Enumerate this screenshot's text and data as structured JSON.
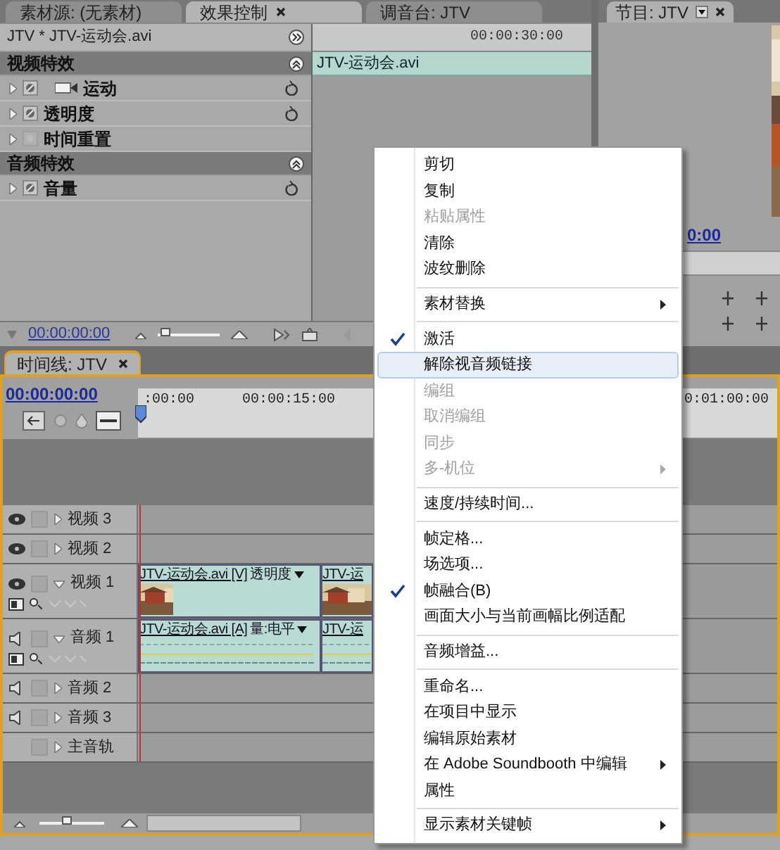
{
  "effect_panel": {
    "tabs": [
      {
        "label": "素材源: (无素材)",
        "selected": false
      },
      {
        "label": "效果控制",
        "selected": true
      },
      {
        "label": "调音台: JTV",
        "selected": false
      }
    ],
    "clip_title": "JTV * JTV-运动会.avi",
    "ruler_time": "00:00:30:00",
    "clip_bar": "JTV-运动会.avi",
    "sections": [
      {
        "title": "视频特效",
        "effects": [
          {
            "name": "运动",
            "kind": "motion",
            "enabled": true,
            "reset_button": true
          },
          {
            "name": "透明度",
            "kind": "plain",
            "enabled": true,
            "reset_button": true
          },
          {
            "name": "时间重置",
            "kind": "plain",
            "enabled": false,
            "reset_button": false
          }
        ]
      },
      {
        "title": "音频特效",
        "effects": [
          {
            "name": "音量",
            "kind": "plain",
            "enabled": true,
            "reset_button": true
          }
        ]
      }
    ],
    "timecode": "00:00:00:00",
    "zoom": {
      "level": 0.05
    }
  },
  "program_panel": {
    "tab": "节目: JTV",
    "timecode": "0:00"
  },
  "timeline": {
    "tab": "时间线: JTV",
    "timecode": "00:00:00:00",
    "ruler": [
      ":00:00",
      "00:00:15:00",
      "0:01:00:00"
    ],
    "tracks": [
      {
        "name": "视频 3",
        "kind": "video",
        "expanded": false
      },
      {
        "name": "视频 2",
        "kind": "video",
        "expanded": false
      },
      {
        "name": "视频 1",
        "kind": "video",
        "expanded": true,
        "clips": [
          {
            "label": "JTV-运动会.avi [V]",
            "effect": "透明度"
          },
          {
            "label": "JTV-运"
          }
        ]
      },
      {
        "name": "音频 1",
        "kind": "audio",
        "expanded": true,
        "clips": [
          {
            "label": "JTV-运动会.avi [A]",
            "effect": "量:电平"
          },
          {
            "label": "JTV-运"
          }
        ]
      },
      {
        "name": "音频 2",
        "kind": "audio",
        "expanded": false
      },
      {
        "name": "音频 3",
        "kind": "audio",
        "expanded": false
      },
      {
        "name": "主音轨",
        "kind": "master",
        "expanded": false
      }
    ],
    "zoom": {
      "level": 0.4
    }
  },
  "context_menu": {
    "items": [
      {
        "kind": "item",
        "label": "剪切",
        "disabled": false,
        "checked": false,
        "selected": false,
        "submenu": false
      },
      {
        "kind": "item",
        "label": "复制",
        "disabled": false,
        "checked": false,
        "selected": false,
        "submenu": false
      },
      {
        "kind": "item",
        "label": "粘贴属性",
        "disabled": true,
        "checked": false,
        "selected": false,
        "submenu": false
      },
      {
        "kind": "item",
        "label": "清除",
        "disabled": false,
        "checked": false,
        "selected": false,
        "submenu": false
      },
      {
        "kind": "item",
        "label": "波纹删除",
        "disabled": false,
        "checked": false,
        "selected": false,
        "submenu": false
      },
      {
        "kind": "separator"
      },
      {
        "kind": "item",
        "label": "素材替换",
        "disabled": false,
        "checked": false,
        "selected": false,
        "submenu": true
      },
      {
        "kind": "separator"
      },
      {
        "kind": "item",
        "label": "激活",
        "disabled": false,
        "checked": true,
        "selected": false,
        "submenu": false
      },
      {
        "kind": "item",
        "label": "解除视音频链接",
        "disabled": false,
        "checked": false,
        "selected": true,
        "submenu": false
      },
      {
        "kind": "item",
        "label": "编组",
        "disabled": true,
        "checked": false,
        "selected": false,
        "submenu": false
      },
      {
        "kind": "item",
        "label": "取消编组",
        "disabled": true,
        "checked": false,
        "selected": false,
        "submenu": false
      },
      {
        "kind": "item",
        "label": "同步",
        "disabled": true,
        "checked": false,
        "selected": false,
        "submenu": false
      },
      {
        "kind": "item",
        "label": "多-机位",
        "disabled": true,
        "checked": false,
        "selected": false,
        "submenu": true
      },
      {
        "kind": "separator"
      },
      {
        "kind": "item",
        "label": "速度/持续时间...",
        "disabled": false,
        "checked": false,
        "selected": false,
        "submenu": false
      },
      {
        "kind": "separator"
      },
      {
        "kind": "item",
        "label": "帧定格...",
        "disabled": false,
        "checked": false,
        "selected": false,
        "submenu": false
      },
      {
        "kind": "item",
        "label": "场选项...",
        "disabled": false,
        "checked": false,
        "selected": false,
        "submenu": false
      },
      {
        "kind": "item",
        "label": "帧融合(B)",
        "disabled": false,
        "checked": true,
        "selected": false,
        "submenu": false
      },
      {
        "kind": "item",
        "label": "画面大小与当前画幅比例适配",
        "disabled": false,
        "checked": false,
        "selected": false,
        "submenu": false
      },
      {
        "kind": "separator"
      },
      {
        "kind": "item",
        "label": "音频增益...",
        "disabled": false,
        "checked": false,
        "selected": false,
        "submenu": false
      },
      {
        "kind": "separator"
      },
      {
        "kind": "item",
        "label": "重命名...",
        "disabled": false,
        "checked": false,
        "selected": false,
        "submenu": false
      },
      {
        "kind": "item",
        "label": "在项目中显示",
        "disabled": false,
        "checked": false,
        "selected": false,
        "submenu": false
      },
      {
        "kind": "item",
        "label": "编辑原始素材",
        "disabled": false,
        "checked": false,
        "selected": false,
        "submenu": false
      },
      {
        "kind": "item",
        "label": "在 Adobe Soundbooth 中编辑",
        "disabled": false,
        "checked": false,
        "selected": false,
        "submenu": true
      },
      {
        "kind": "item",
        "label": "属性",
        "disabled": false,
        "checked": false,
        "selected": false,
        "submenu": false
      },
      {
        "kind": "separator"
      },
      {
        "kind": "item",
        "label": "显示素材关键帧",
        "disabled": false,
        "checked": false,
        "selected": false,
        "submenu": true
      }
    ]
  }
}
